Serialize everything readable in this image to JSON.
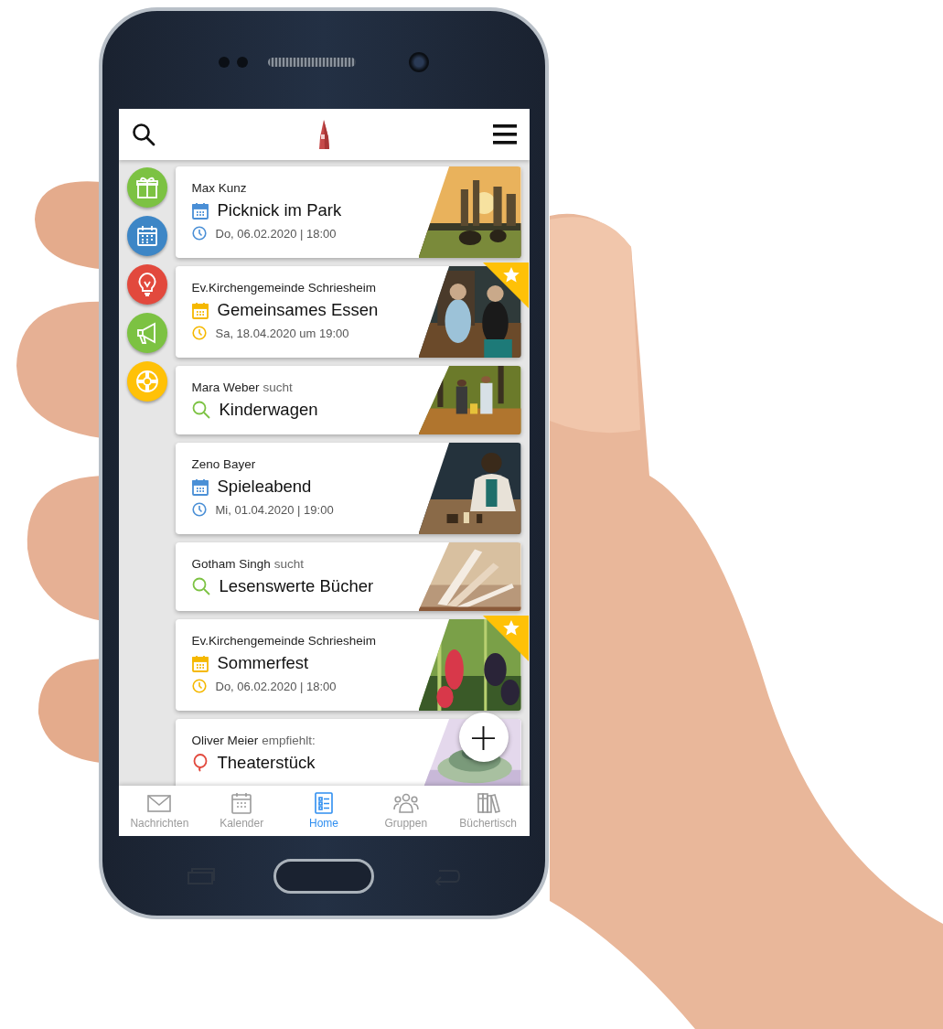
{
  "sidebar": [
    {
      "color": "#7cc242"
    },
    {
      "color": "#3d86c6"
    },
    {
      "color": "#e2493d"
    },
    {
      "color": "#7cc242"
    },
    {
      "color": "#ffc107"
    }
  ],
  "cards": [
    {
      "kind": "event",
      "author": "Max Kunz",
      "title": "Picknick im Park",
      "date": "Do, 06.02.2020 | 18:00",
      "color": "#4a8fd6",
      "featured": false
    },
    {
      "kind": "event",
      "author": "Ev.Kirchengemeinde Schriesheim",
      "title": "Gemeinsames Essen",
      "date": "Sa, 18.04.2020 um 19:00",
      "color": "#f5b800",
      "featured": true
    },
    {
      "kind": "search",
      "author": "Mara Weber",
      "verb": "sucht",
      "title": "Kinderwagen",
      "color": "#7cc242",
      "featured": false
    },
    {
      "kind": "event",
      "author": "Zeno Bayer",
      "title": "Spieleabend",
      "date": "Mi, 01.04.2020 | 19:00",
      "color": "#4a8fd6",
      "featured": false
    },
    {
      "kind": "search",
      "author": "Gotham Singh",
      "verb": "sucht",
      "title": "Lesenswerte Bücher",
      "color": "#7cc242",
      "featured": false
    },
    {
      "kind": "event",
      "author": "Ev.Kirchengemeinde Schriesheim",
      "title": "Sommerfest",
      "date": "Do, 06.02.2020 | 18:00",
      "color": "#f5b800",
      "featured": true
    },
    {
      "kind": "recommend",
      "author": "Oliver Meier",
      "verb": "empfiehlt:",
      "title": "Theaterstück",
      "color": "#e2493d",
      "featured": false
    }
  ],
  "fab": {
    "label": "+"
  },
  "tabs": [
    {
      "label": "Nachrichten",
      "selected": false
    },
    {
      "label": "Kalender",
      "selected": false
    },
    {
      "label": "Home",
      "selected": true
    },
    {
      "label": "Gruppen",
      "selected": false
    },
    {
      "label": "Büchertisch",
      "selected": false
    }
  ]
}
